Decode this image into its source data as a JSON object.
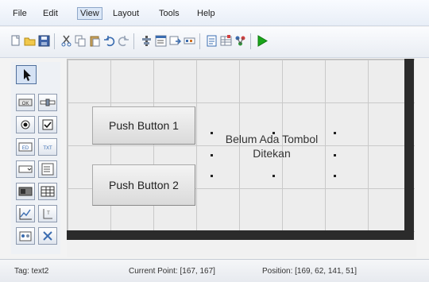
{
  "menu": {
    "items": [
      {
        "label": "File"
      },
      {
        "label": "Edit"
      },
      {
        "label": "View"
      },
      {
        "label": "Layout"
      },
      {
        "label": "Tools"
      },
      {
        "label": "Help"
      }
    ],
    "active": "View"
  },
  "toolbar": {
    "icons": [
      "new-icon",
      "open-icon",
      "save-icon",
      "cut-icon",
      "copy-icon",
      "paste-icon",
      "undo-icon",
      "redo-icon",
      "align-icon",
      "menu-editor-icon",
      "tab-order-icon",
      "toolbar-editor-icon",
      "mfile-editor-icon",
      "property-inspector-icon",
      "object-browser-icon",
      "run-icon"
    ],
    "accent": "#1aa51a"
  },
  "palette": {
    "tools": [
      "select-tool-icon",
      "push-button-tool-icon",
      "slider-tool-icon",
      "radio-button-tool-icon",
      "checkbox-tool-icon",
      "edit-text-tool-icon",
      "static-text-tool-icon",
      "popup-menu-tool-icon",
      "listbox-tool-icon",
      "toggle-button-tool-icon",
      "table-tool-icon",
      "axes-tool-icon",
      "panel-tool-icon",
      "button-group-tool-icon",
      "activex-tool-icon"
    ]
  },
  "layout": {
    "push_button_1": "Push Button 1",
    "push_button_2": "Push Button 2",
    "static_text_line1": "Belum Ada Tombol",
    "static_text_line2": "Ditekan"
  },
  "status": {
    "tag": "Tag: text2",
    "current_point": "Current Point:  [167, 167]",
    "position": "Position:  [169, 62, 141, 51]"
  }
}
